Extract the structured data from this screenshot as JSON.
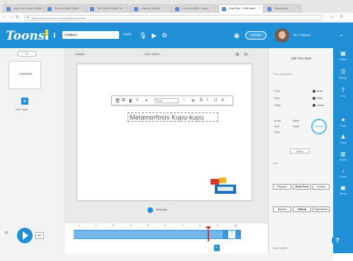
{
  "browser": {
    "tabs": [
      {
        "label": "Join Live Class Online"
      },
      {
        "label": "Toonie Flash Slides"
      },
      {
        "label": "Tab Video Editor Pro"
      },
      {
        "label": "Cartoon Studio"
      },
      {
        "label": "Lesson editor - Anim"
      },
      {
        "label": "PowToon - Edit video"
      },
      {
        "label": "Storyboard"
      }
    ],
    "url": "https://www.powtoon.com/edit/studio/#/edit"
  },
  "toolbar": {
    "logo": "Toons",
    "title_value": "Untitled",
    "undo_label": "Undo",
    "share_label": "Publish",
    "user_name": "Nur Hidayat"
  },
  "slides": {
    "counter": "1/1",
    "add_label": "Add Slide"
  },
  "canvas": {
    "back_label": "Back",
    "size_label": "Size 100%",
    "textbox_text": "Metamorfosis Kupu-kupu",
    "font_value": "Font",
    "present_label": "Preview"
  },
  "properties": {
    "title": "Edit Text Style",
    "section_label": "Text properties",
    "rows": [
      "Font",
      "Size",
      "Style"
    ],
    "radios": [
      "Bold",
      "Italic",
      "Under"
    ],
    "anim_rows": [
      "Enter",
      "Exit",
      "Pop",
      "Slide",
      "Fade"
    ],
    "anim_circle": "NONE",
    "apply_label": "Apply",
    "styles_label": "Text",
    "style_chips": [
      "Regular",
      "Bold Font",
      "Classic",
      "Marker",
      "Stamp",
      "Typewriter"
    ],
    "more_label": "More styles"
  },
  "rail": [
    {
      "icon": "▦",
      "label": "Layout"
    },
    {
      "icon": "☰",
      "label": "Backgr."
    },
    {
      "icon": "T",
      "label": "Text"
    },
    {
      "icon": "★",
      "label": "Props"
    },
    {
      "icon": "♟",
      "label": "Chars"
    },
    {
      "icon": "▥",
      "label": "Charts"
    },
    {
      "icon": "♪",
      "label": "Music"
    },
    {
      "icon": "▣",
      "label": "Media"
    }
  ],
  "timeline": {
    "ticks": [
      "1",
      "2",
      "3",
      "4",
      "5",
      "6",
      "7",
      "8",
      "9",
      "10"
    ],
    "marker": "+",
    "end_icon": "T",
    "progress": 0.8
  },
  "colors": {
    "accent": "#1f8fd6",
    "timeline": "#3c97dc",
    "playhead": "#c23a3a"
  }
}
